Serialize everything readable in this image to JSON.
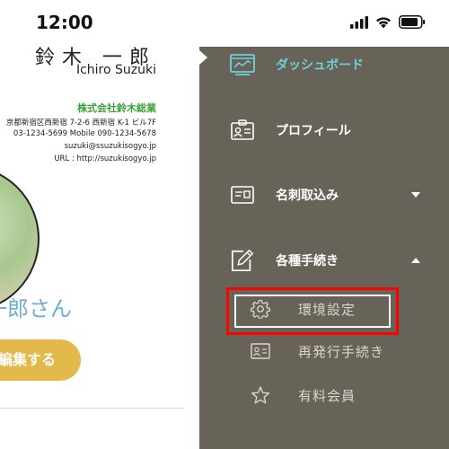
{
  "status_bar": {
    "time": "12:00"
  },
  "business_card": {
    "name_jp": "鈴木 一郎",
    "name_en": "Ichiro Suzuki",
    "company": "株式会社鈴木総業",
    "address": "京都新宿区西新宿 7-2-6 西新宿 K-1 ビル7F",
    "phone": "03-1234-5699 Mobile 090-1234-5678",
    "email": "suzuki@ssuzukisogyo.jp",
    "url": "URL : http://suzukisogyo.jp"
  },
  "greeting": "一郎さん",
  "edit_button_label": "編集する",
  "menu": {
    "items": [
      {
        "label": "ダッシュボード",
        "icon": "dashboard-icon",
        "active": true
      },
      {
        "label": "プロフィール",
        "icon": "profile-card-icon"
      },
      {
        "label": "名刺取込み",
        "icon": "business-card-icon",
        "chevron": "down"
      },
      {
        "label": "各種手続き",
        "icon": "edit-document-icon",
        "chevron": "up"
      }
    ],
    "sub_items": [
      {
        "label": "環境設定",
        "icon": "gear-icon",
        "highlighted": true
      },
      {
        "label": "再発行手続き",
        "icon": "id-card-icon"
      },
      {
        "label": "有料会員",
        "icon": "star-icon"
      }
    ]
  },
  "colors": {
    "drawer_bg": "#686359",
    "active_label": "#6fd0d8",
    "highlight_border": "#ff0000",
    "company_green": "#3aa23a",
    "greeting_blue": "#6aaed0",
    "edit_button": "#e2b94a"
  }
}
